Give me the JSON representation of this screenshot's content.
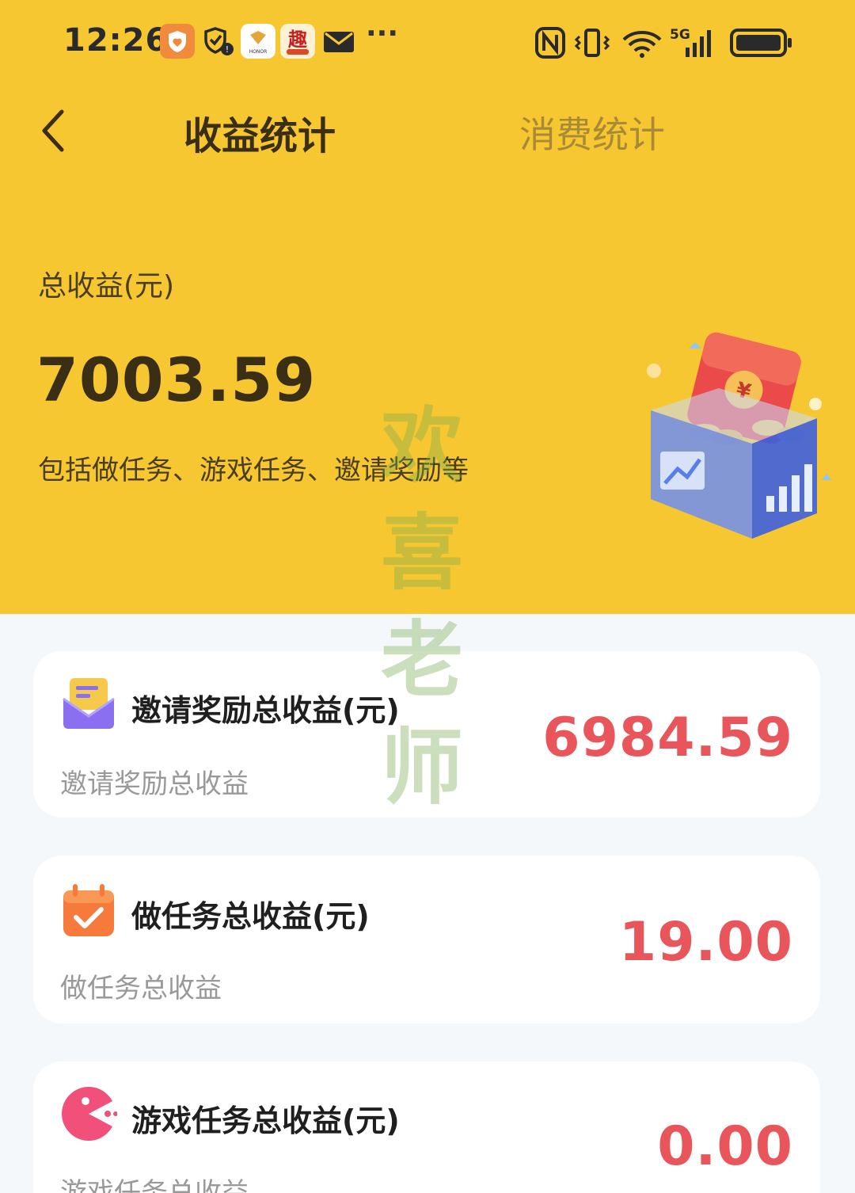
{
  "status_bar": {
    "time": "12:26",
    "notification_icons": [
      "shield-heart-icon",
      "vpn-shield-icon",
      "honor-app-icon",
      "qu-app-icon",
      "mail-icon"
    ],
    "more": "···",
    "honor_label": "HONOR",
    "qu_label": "趣",
    "network": "5G",
    "system_icons": [
      "nfc-icon",
      "vibrate-icon",
      "wifi-icon",
      "signal-icon",
      "battery-icon"
    ]
  },
  "nav": {
    "tab_active": "收益统计",
    "tab_inactive": "消费统计"
  },
  "summary": {
    "label": "总收益(元)",
    "value": "7003.59",
    "description": "包括做任务、游戏任务、邀请奖励等"
  },
  "cards": [
    {
      "icon": "envelope-icon",
      "title": "邀请奖励总收益(元)",
      "subtitle": "邀请奖励总收益",
      "amount": "6984.59"
    },
    {
      "icon": "calendar-check-icon",
      "title": "做任务总收益(元)",
      "subtitle": "做任务总收益",
      "amount": "19.00"
    },
    {
      "icon": "pacman-icon",
      "title": "游戏任务总收益(元)",
      "subtitle": "游戏任务总收益",
      "amount": "0.00"
    }
  ],
  "watermark": [
    "欢",
    "喜",
    "老",
    "师"
  ],
  "colors": {
    "header_bg": "#f7c731",
    "amount": "#e8555a",
    "page_bg": "#f4f8fa"
  }
}
